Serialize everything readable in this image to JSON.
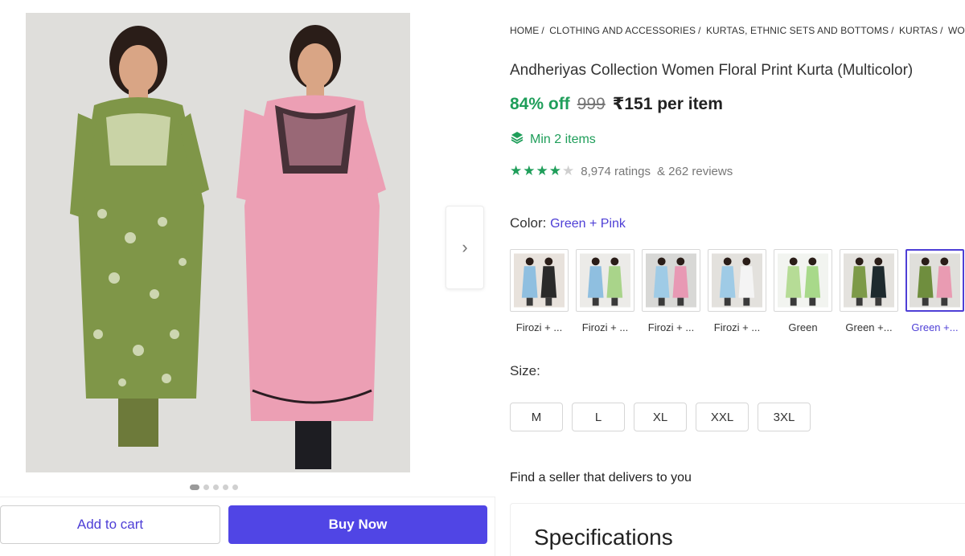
{
  "breadcrumb": [
    "HOME",
    "CLOTHING AND ACCESSORIES",
    "KURTAS, ETHNIC SETS AND BOTTOMS",
    "KURTAS",
    "WOMEN"
  ],
  "product": {
    "title": "Andheriyas Collection Women Floral Print Kurta (Multicolor)",
    "discount": "84% off",
    "mrp": "999",
    "price": "₹151 per item",
    "min_items": "Min 2 items",
    "rating": {
      "stars": 4,
      "max_stars": 5,
      "ratings_text": "8,974 ratings",
      "reviews_text": "& 262 reviews"
    }
  },
  "color": {
    "label": "Color:",
    "selected": "Green + Pink",
    "options": [
      {
        "label": "Firozi + ...",
        "colors": [
          "#8fbfe0",
          "#2a2a2a"
        ],
        "bg": "#e8e2dc",
        "selected": false
      },
      {
        "label": "Firozi + ...",
        "colors": [
          "#8fbfe0",
          "#a9d48a"
        ],
        "bg": "#ecebe8",
        "selected": false
      },
      {
        "label": "Firozi + ...",
        "colors": [
          "#9fcbe6",
          "#e899b4"
        ],
        "bg": "#d8d8d6",
        "selected": false
      },
      {
        "label": "Firozi + ...",
        "colors": [
          "#9fcbe6",
          "#f4f4f4"
        ],
        "bg": "#e3e1dd",
        "selected": false
      },
      {
        "label": "Green",
        "colors": [
          "#b6dc96",
          "#a8d98a"
        ],
        "bg": "#f2f4f0",
        "selected": false
      },
      {
        "label": "Green +...",
        "colors": [
          "#7d9a48",
          "#1e2a2e"
        ],
        "bg": "#e4e2de",
        "selected": false
      },
      {
        "label": "Green +...",
        "colors": [
          "#6f8e3e",
          "#e99bb2"
        ],
        "bg": "#e0dfdb",
        "selected": true
      }
    ]
  },
  "size": {
    "label": "Size:",
    "options": [
      "M",
      "L",
      "XL",
      "XXL",
      "3XL"
    ]
  },
  "seller_text": "Find a seller that delivers to you",
  "specifications_title": "Specifications",
  "actions": {
    "add_to_cart": "Add to cart",
    "buy_now": "Buy Now"
  },
  "carousel": {
    "pages": 5,
    "active": 0
  },
  "theme": {
    "accent": "#5045e5",
    "success": "#1f9e5a"
  }
}
